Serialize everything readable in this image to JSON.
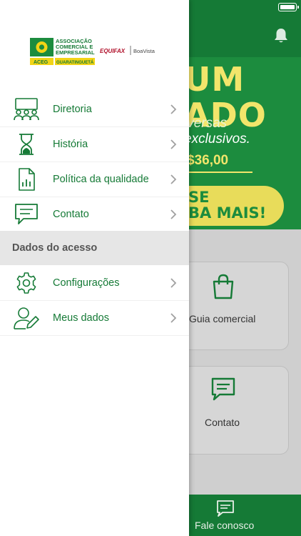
{
  "status_bar": {
    "battery_level": 1.0
  },
  "banner": {
    "line1": "UM",
    "line2": "ADO",
    "line3": "iversas",
    "line4": "exclusivos.",
    "price": "$36,00",
    "cta_line1": "SE",
    "cta_line2": "BA MAIS!"
  },
  "cards": [
    {
      "label": "Guia comercial",
      "icon": "shopping-bag-icon"
    },
    {
      "label": "Contato",
      "icon": "chat-icon"
    }
  ],
  "bottom_bar": {
    "label": "Fale conosco",
    "icon": "chat-icon"
  },
  "drawer": {
    "logo": {
      "line1": "ASSOCIAÇÃO",
      "line2": "COMERCIAL E",
      "line3": "EMPRESARIAL",
      "badge": "ACEG",
      "city": "GUARATINGUETÁ",
      "partner": "EQUIFAX",
      "partner2": "BoaVista"
    },
    "menu": [
      {
        "label": "Diretoria",
        "icon": "board-meeting-icon"
      },
      {
        "label": "História",
        "icon": "hourglass-icon"
      },
      {
        "label": "Política da qualidade",
        "icon": "document-chart-icon"
      },
      {
        "label": "Contato",
        "icon": "chat-icon"
      }
    ],
    "section_title": "Dados do acesso",
    "access_menu": [
      {
        "label": "Configurações",
        "icon": "gear-icon"
      },
      {
        "label": "Meus dados",
        "icon": "user-edit-icon"
      }
    ]
  },
  "colors": {
    "brand_green": "#157a36",
    "banner_green": "#1c8c3e",
    "banner_yellow": "#f2e56b"
  }
}
